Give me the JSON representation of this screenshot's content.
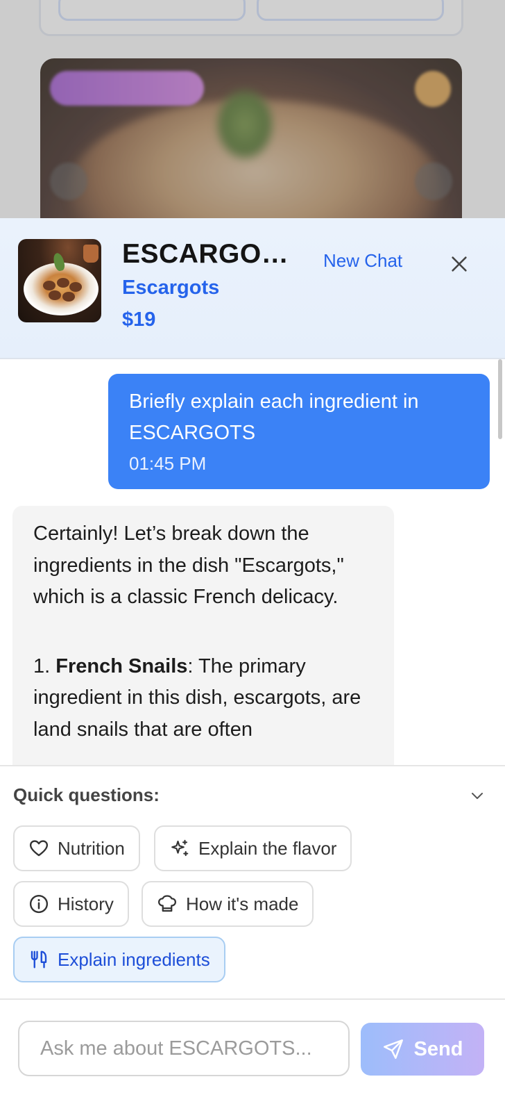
{
  "header": {
    "title": "ESCARGOTS",
    "subtitle": "Escargots",
    "price": "$19",
    "new_chat_label": "New Chat",
    "close_icon": "close-icon"
  },
  "messages": {
    "user": {
      "text": "Briefly explain each ingredient in ESCARGOTS",
      "time": "01:45 PM"
    },
    "assistant": {
      "intro": "Certainly! Let’s break down the ingredients in the dish \"Escargots,\" which is a classic French delicacy.",
      "item_number": "1. ",
      "item_title": "French Snails",
      "item_text": ": The primary ingredient in this dish, escargots, are land snails that are often"
    }
  },
  "quick_questions": {
    "label": "Quick questions:",
    "toggle_icon": "chevron-down-icon",
    "chips": [
      {
        "label": "Nutrition",
        "icon": "heart-icon"
      },
      {
        "label": "Explain the flavor",
        "icon": "sparkles-icon"
      },
      {
        "label": "History",
        "icon": "info-icon"
      },
      {
        "label": "How it's made",
        "icon": "chef-hat-icon"
      },
      {
        "label": "Explain ingredients",
        "icon": "utensils-icon",
        "selected": true
      }
    ]
  },
  "input": {
    "placeholder": "Ask me about ESCARGOTS...",
    "value": "",
    "send_label": "Send",
    "send_icon": "send-icon"
  },
  "colors": {
    "accent": "#2563eb",
    "user_bubble": "#3b82f6",
    "assistant_bubble": "#f4f4f4",
    "header_bg": "#e8f0fb"
  }
}
